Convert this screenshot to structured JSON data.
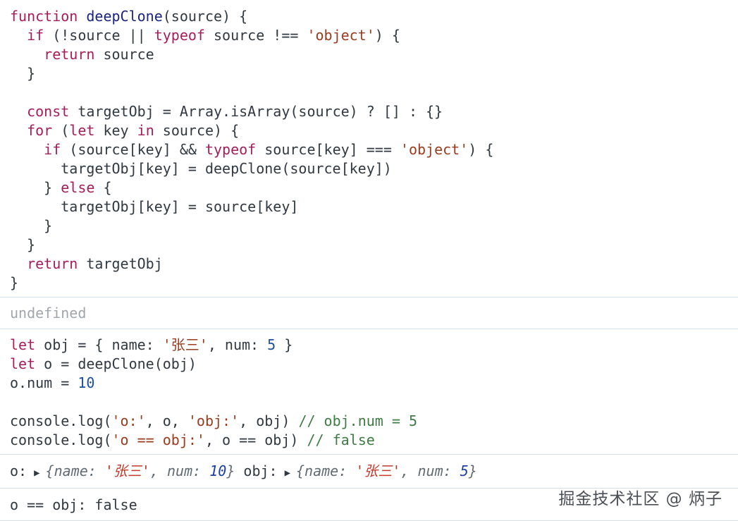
{
  "entry1": {
    "lines": [
      [
        "function",
        " ",
        "deepClone",
        "(source) {"
      ],
      [
        "  if",
        " (!source || ",
        "typeof",
        " source !== ",
        "'object'",
        ") {"
      ],
      [
        "    return",
        " source"
      ],
      [
        "  }"
      ],
      [
        ""
      ],
      [
        "  const",
        " targetObj = Array.isArray(source) ? [] : {}"
      ],
      [
        "  for",
        " (",
        "let",
        " key ",
        "in",
        " source) {"
      ],
      [
        "    if",
        " (source[key] && ",
        "typeof",
        " source[key] === ",
        "'object'",
        ") {"
      ],
      [
        "      targetObj[key] = deepClone(source[key])"
      ],
      [
        "    } ",
        "else",
        " {"
      ],
      [
        "      targetObj[key] = source[key]"
      ],
      [
        "    }"
      ],
      [
        "  }"
      ],
      [
        "  return",
        " targetObj"
      ],
      [
        "}"
      ]
    ]
  },
  "entry2": {
    "result": "undefined"
  },
  "entry3": {
    "l1": [
      "let",
      " obj = { name: ",
      "'张三'",
      ", num: ",
      "5",
      " }"
    ],
    "l2": [
      "let",
      " o = deepClone(obj)"
    ],
    "l3": [
      "o.num = ",
      "10"
    ],
    "l4": [
      ""
    ],
    "l5": [
      "console.log(",
      "'o:'",
      ", o, ",
      "'obj:'",
      ", obj) ",
      "// obj.num = 5"
    ],
    "l6": [
      "console.log(",
      "'o == obj:'",
      ", o == obj) ",
      "// false"
    ]
  },
  "entry4": {
    "label1": "o:",
    "prev1": [
      "{name: ",
      "'张三'",
      ", num: ",
      "10",
      "}"
    ],
    "label2": "obj:",
    "prev2": [
      "{name: ",
      "'张三'",
      ", num: ",
      "5",
      "}"
    ]
  },
  "entry5": {
    "text": "o == obj: false"
  },
  "watermark": "掘金技术社区 @ 炳子"
}
